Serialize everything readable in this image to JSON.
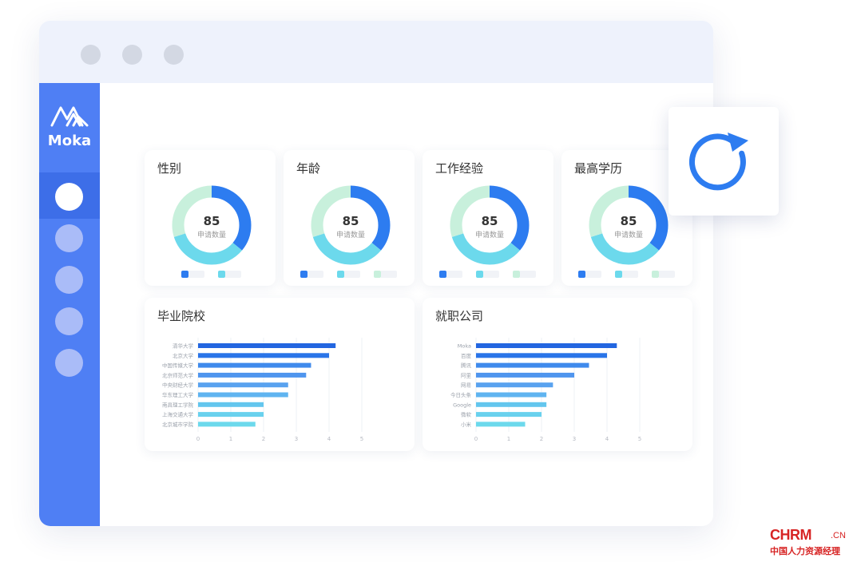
{
  "app": {
    "name": "Moka"
  },
  "sidebar": {
    "items": [
      {
        "name": "nav-item-1",
        "active": true
      },
      {
        "name": "nav-item-2",
        "active": false
      },
      {
        "name": "nav-item-3",
        "active": false
      },
      {
        "name": "nav-item-4",
        "active": false
      },
      {
        "name": "nav-item-5",
        "active": false
      }
    ]
  },
  "colors": {
    "accent": "#4f7ff4",
    "series1": "#2d7cf0",
    "series2": "#6cd9ec",
    "series3": "#c8f0dc"
  },
  "donut_cards": [
    {
      "title": "性别",
      "value": "85",
      "subtitle": "申请数量",
      "segments": [
        0.36,
        0.34,
        0.3
      ],
      "legend_count": 2
    },
    {
      "title": "年龄",
      "value": "85",
      "subtitle": "申请数量",
      "segments": [
        0.36,
        0.34,
        0.3
      ],
      "legend_count": 3
    },
    {
      "title": "工作经验",
      "value": "85",
      "subtitle": "申请数量",
      "segments": [
        0.36,
        0.34,
        0.3
      ],
      "legend_count": 3
    },
    {
      "title": "最高学历",
      "value": "85",
      "subtitle": "申请数量",
      "segments": [
        0.36,
        0.34,
        0.3
      ],
      "legend_count": 3
    }
  ],
  "chart_data": [
    {
      "type": "bar",
      "orientation": "horizontal",
      "title": "毕业院校",
      "categories": [
        "清华大学",
        "北京大学",
        "中国传媒大学",
        "北京师范大学",
        "中央财经大学",
        "华东理工大学",
        "南昌理工学院",
        "上海交通大学",
        "北京城市学院"
      ],
      "values": [
        4.2,
        4.0,
        3.45,
        3.3,
        2.75,
        2.75,
        2.0,
        2.0,
        1.75
      ],
      "xlim": [
        0,
        5
      ],
      "xticks": [
        "0",
        "1",
        "2",
        "3",
        "4",
        "5"
      ],
      "grid": true
    },
    {
      "type": "bar",
      "orientation": "horizontal",
      "title": "就职公司",
      "categories": [
        "Moka",
        "百度",
        "腾讯",
        "阿里",
        "网易",
        "今日头条",
        "Google",
        "微软",
        "小米"
      ],
      "values": [
        4.3,
        4.0,
        3.45,
        3.0,
        2.35,
        2.15,
        2.15,
        2.0,
        1.5
      ],
      "xlim": [
        0,
        5
      ],
      "xticks": [
        "0",
        "1",
        "2",
        "3",
        "4",
        "5"
      ],
      "grid": true
    }
  ],
  "refresh": {
    "icon": "refresh-icon"
  },
  "watermark": {
    "main": "CHRM",
    "suffix": ".CN",
    "sub": "中国人力资源经理"
  }
}
